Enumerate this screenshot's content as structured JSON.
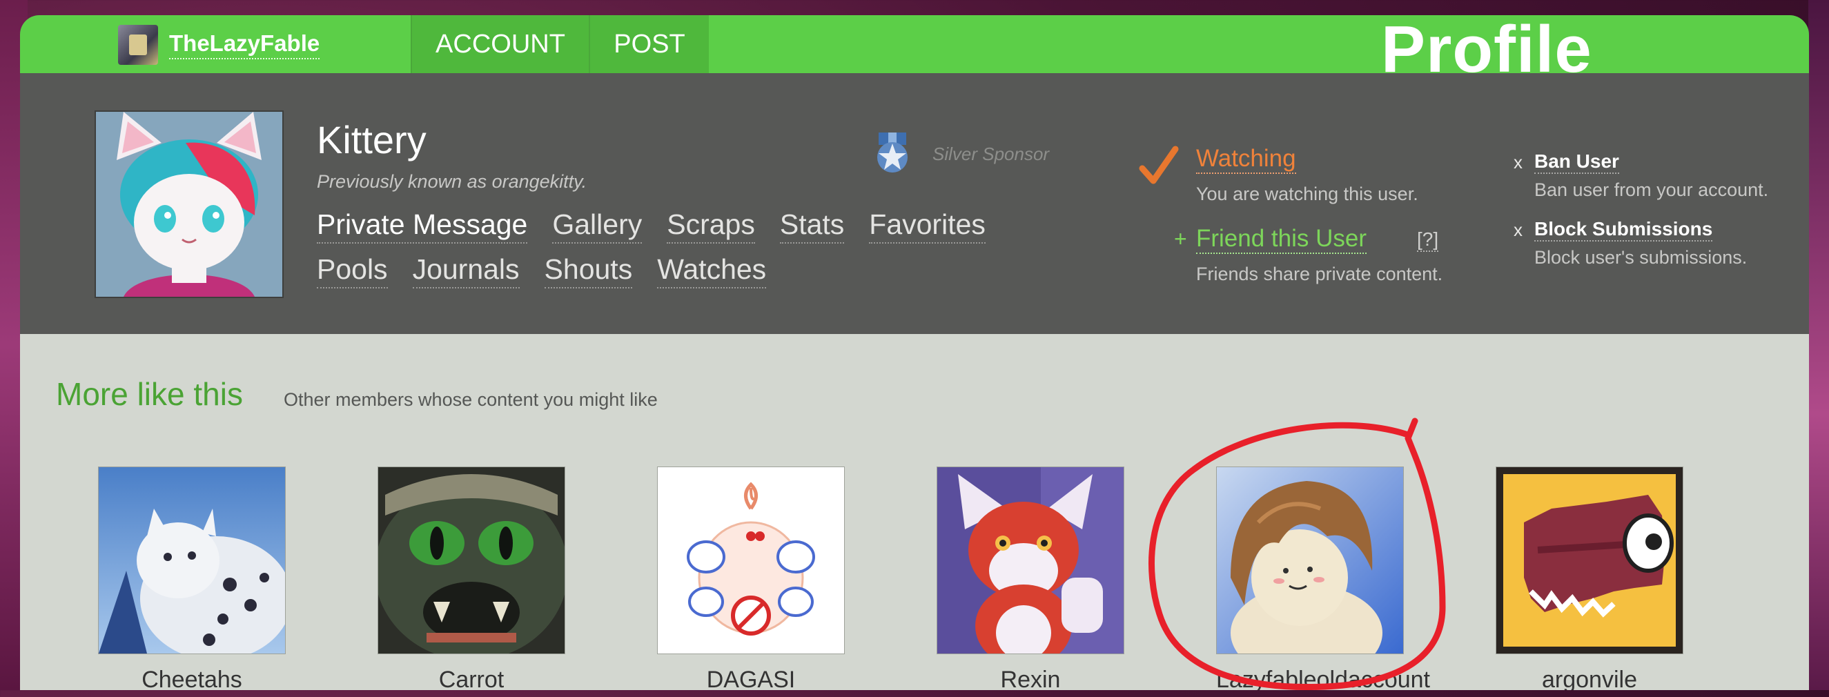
{
  "colors": {
    "nav_green": "#5ccf48",
    "header_dark": "#575856",
    "content_bg": "#d3d7d0",
    "watching_orange": "#f0823a",
    "friend_green": "#7dd65a",
    "heading_green": "#4aa334",
    "annotation_red": "#e8202a"
  },
  "topnav": {
    "username": "TheLazyFable",
    "user_avatar_icon": "user-avatar",
    "account_label": "ACCOUNT",
    "post_label": "POST",
    "section_title": "Profile"
  },
  "profile": {
    "name": "Kittery",
    "previously_known": "Previously known as orangekitty.",
    "sponsor_label": "Silver Sponsor",
    "sponsor_icon": "ribbon-star-icon",
    "links_row1": [
      "Private Message",
      "Gallery",
      "Scraps",
      "Stats",
      "Favorites"
    ],
    "links_row2": [
      "Pools",
      "Journals",
      "Shouts",
      "Watches"
    ]
  },
  "watch": {
    "title": "Watching",
    "desc": "You are watching this user.",
    "icon": "checkmark-icon"
  },
  "friend": {
    "plus": "+",
    "title": "Friend this User",
    "help": "[?]",
    "desc": "Friends share private content."
  },
  "actions": [
    {
      "x": "x",
      "title": "Ban User",
      "desc": "Ban user from your account."
    },
    {
      "x": "x",
      "title": "Block Submissions",
      "desc": "Block user's submissions."
    }
  ],
  "more": {
    "title": "More like this",
    "subtitle": "Other members whose content you might like",
    "members": [
      {
        "name": "Cheetahs"
      },
      {
        "name": "Carrot"
      },
      {
        "name": "DAGASI"
      },
      {
        "name": "Rexin"
      },
      {
        "name": "Lazyfableoldaccount",
        "circled": true
      },
      {
        "name": "argonvile"
      }
    ]
  }
}
